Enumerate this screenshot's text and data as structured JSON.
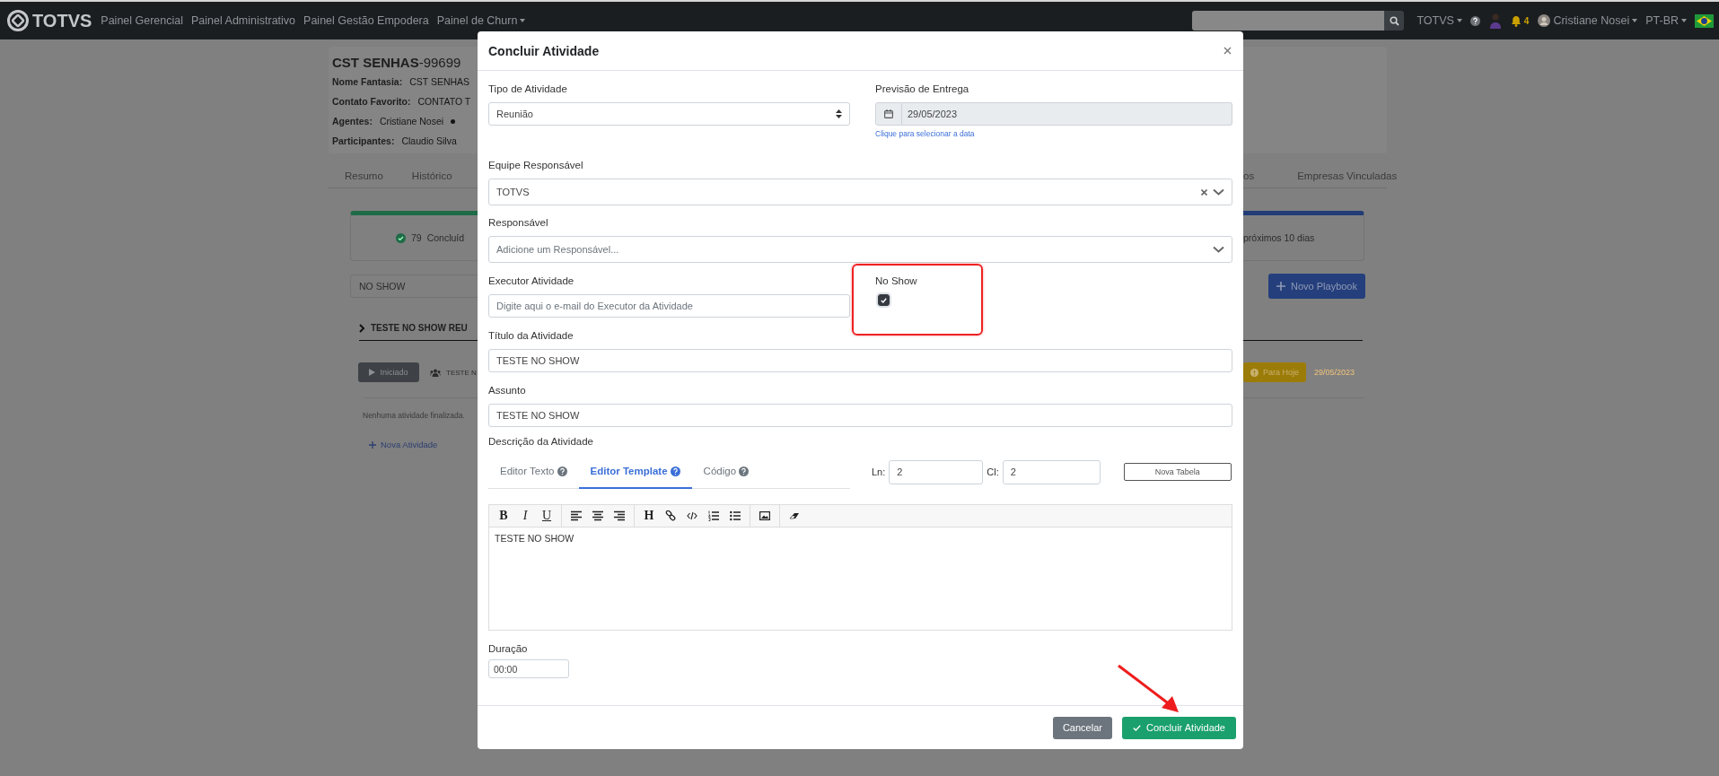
{
  "topbar": {
    "brand": "TOTVS",
    "nav": [
      {
        "label": "Painel Gerencial",
        "dropdown": false
      },
      {
        "label": "Painel Administrativo",
        "dropdown": false
      },
      {
        "label": "Painel Gestão Empodera",
        "dropdown": false
      },
      {
        "label": "Painel de Churn",
        "dropdown": true
      }
    ],
    "org": "TOTVS",
    "notifications": "4",
    "user": "Cristiane Nosei",
    "language": "PT-BR"
  },
  "background": {
    "title": "**CST SENHAS**-99699",
    "details": [
      {
        "label": "Nome Fantasia:",
        "value": "CST SENHAS"
      },
      {
        "label": "Contato Favorito:",
        "value": "CONTATO T"
      },
      {
        "label": "Agentes:",
        "value": "Cristiane Nosei",
        "dot": true
      },
      {
        "label": "Participantes:",
        "value": "Claudio Silva"
      }
    ],
    "tabs_left": [
      "Resumo",
      "Histórico"
    ],
    "tabs_right": [
      "os",
      "Empresas Vinculadas"
    ],
    "summary": {
      "count": "79",
      "text": "Concluíd",
      "right_text": "próximos 10 dias"
    },
    "filter": {
      "value": "NO SHOW"
    },
    "new_playbook": "Novo Playbook",
    "playbook": {
      "title": "TESTE NO SHOW REU",
      "status": "Iniciado",
      "activity": "TESTE N",
      "due": "Para Hoje",
      "date": "29/05/2023"
    },
    "empty": "Nenhuma atividade finalizada.",
    "add": "Nova Atividade"
  },
  "modal": {
    "title": "Concluir Atividade",
    "tipo": {
      "label": "Tipo de Atividade",
      "value": "Reunião"
    },
    "previsao": {
      "label": "Previsão de Entrega",
      "value": "29/05/2023",
      "help": "Clique para selecionar a data"
    },
    "equipe": {
      "label": "Equipe Responsável",
      "value": "TOTVS"
    },
    "responsavel": {
      "label": "Responsável",
      "placeholder": "Adicione um Responsável..."
    },
    "executor": {
      "label": "Executor Atividade",
      "placeholder": "Digite aqui o e-mail do Executor da Atividade"
    },
    "no_show": {
      "label": "No Show",
      "checked": true
    },
    "titulo": {
      "label": "Título da Atividade",
      "value": "TESTE NO SHOW"
    },
    "assunto": {
      "label": "Assunto",
      "value": "TESTE NO SHOW"
    },
    "descricao": {
      "label": "Descrição da Atividade",
      "tabs": [
        {
          "label": "Editor Texto",
          "selected": false
        },
        {
          "label": "Editor Template",
          "selected": true
        },
        {
          "label": "Código",
          "selected": false
        }
      ],
      "rows_label": "Ln:",
      "rows": "2",
      "cols_label": "Cl:",
      "cols": "2",
      "new_table": "Nova Tabela",
      "format": [
        "B",
        "I",
        "U"
      ],
      "heading": "H",
      "content": "TESTE NO SHOW"
    },
    "duracao": {
      "label": "Duração",
      "value": "00:00"
    },
    "buttons": [
      {
        "label": "Cancelar",
        "kind": "secondary"
      },
      {
        "label": "Concluir Atividade",
        "kind": "primary"
      }
    ]
  }
}
